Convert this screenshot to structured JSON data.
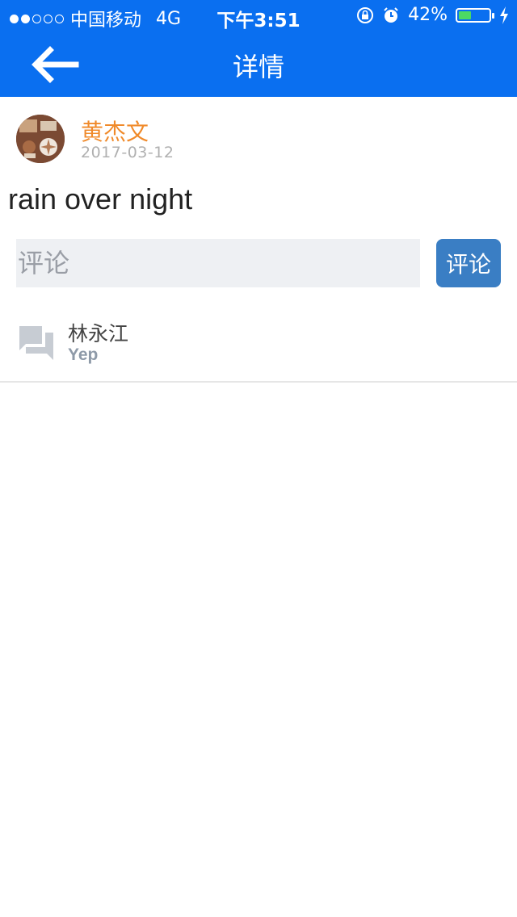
{
  "status_bar": {
    "signal_full": 2,
    "signal_total": 5,
    "carrier": "中国移动",
    "network": "4G",
    "time": "下午3:51",
    "battery_percent_label": "42%",
    "battery_level": 0.42
  },
  "nav": {
    "title": "详情",
    "back_icon": "arrow-left-icon"
  },
  "post": {
    "author": "黄杰文",
    "date": "2017-03-12",
    "content": "rain over night"
  },
  "comment_form": {
    "placeholder": "评论",
    "value": "",
    "submit_label": "评论"
  },
  "comments": [
    {
      "icon": "chat-bubbles-icon",
      "name": "林永江",
      "text": "Yep"
    }
  ],
  "colors": {
    "nav_bg": "#0a6ff0",
    "author_name": "#f08a2a",
    "submit_button": "#3a7ec4",
    "input_bg": "#eef0f3",
    "battery_fill": "#4cd964"
  }
}
